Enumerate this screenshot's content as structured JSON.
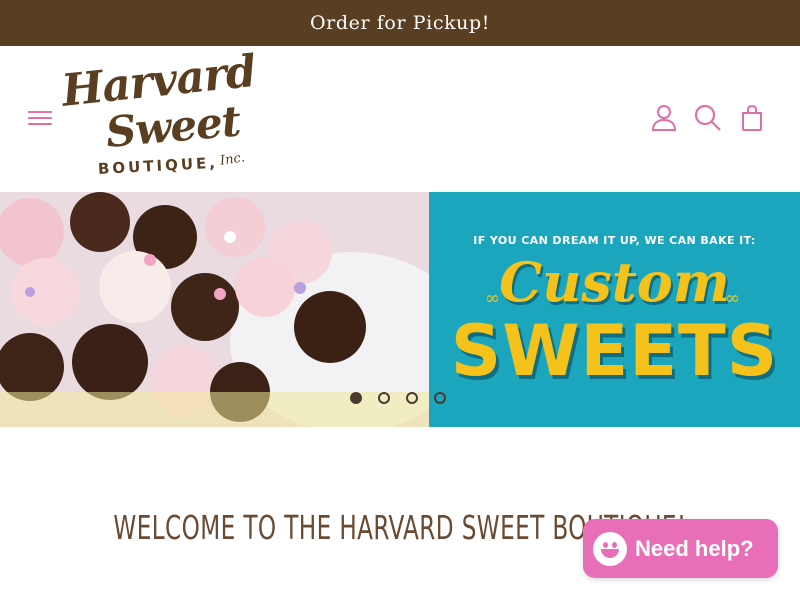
{
  "announcement": {
    "text": "Order for Pickup!"
  },
  "header": {
    "logo": {
      "line1": "Harvard",
      "line2": "Sweet",
      "line3": "BOUTIQUE,",
      "line4": "Inc."
    },
    "icons": [
      "menu-icon",
      "account-icon",
      "search-icon",
      "cart-icon"
    ],
    "accent_color": "#e06fa7"
  },
  "hero": {
    "promo_tag": "IF YOU CAN DREAM IT UP, WE CAN BAKE IT:",
    "promo_script": "Custom",
    "promo_big": "SWEETS",
    "slides_count": 4,
    "active_slide": 1,
    "colors": {
      "promo_bg": "#1ba6bd",
      "promo_text": "#f4c21a"
    }
  },
  "main": {
    "welcome_heading": "WELCOME TO THE HARVARD SWEET BOUTIQUE!"
  },
  "chat": {
    "label": "Need help?",
    "color": "#e86fb7"
  },
  "colors": {
    "brand_brown": "#5a3e22"
  }
}
